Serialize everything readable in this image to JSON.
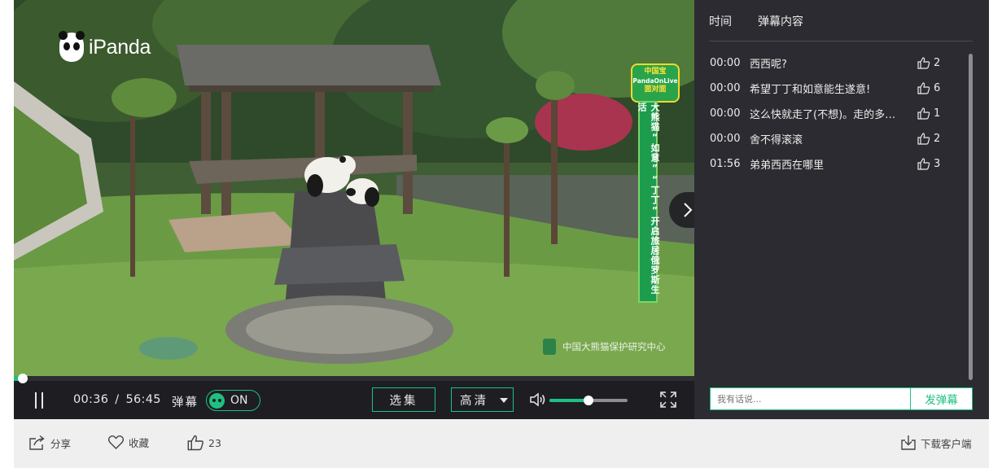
{
  "logo": {
    "text": "iPanda"
  },
  "video": {
    "banner_lines": [
      "中国宝",
      "PandaOnLive",
      "面对面"
    ],
    "vertical_banner": "大熊猫“如意”“丁丁”开启旅居俄罗斯生活",
    "watermark": "中国大熊猫保护研究中心"
  },
  "player": {
    "progress_fraction": 0.008,
    "current_time": "00:36",
    "separator": "/",
    "duration": "56:45",
    "danmu_label": "弹幕",
    "toggle_state": "ON",
    "select_episode_label": "选集",
    "quality_label": "高清",
    "volume_fraction": 0.5,
    "accent_color": "#1ec083"
  },
  "panel": {
    "col_time": "时间",
    "col_content": "弹幕内容",
    "comments": [
      {
        "time": "00:00",
        "text": "西西呢?",
        "likes": "2"
      },
      {
        "time": "00:00",
        "text": "希望丁丁和如意能生遂意!",
        "likes": "6"
      },
      {
        "time": "00:00",
        "text": "这么快就走了(不想)。走的多回...",
        "likes": "1"
      },
      {
        "time": "00:00",
        "text": "舍不得滚滚",
        "likes": "2"
      },
      {
        "time": "01:56",
        "text": "弟弟西西在哪里",
        "likes": "3"
      }
    ],
    "input_placeholder": "我有话说...",
    "send_label": "发弹幕"
  },
  "bottom": {
    "share": "分享",
    "favorite": "收藏",
    "like_count": "23",
    "download": "下载客户端"
  }
}
